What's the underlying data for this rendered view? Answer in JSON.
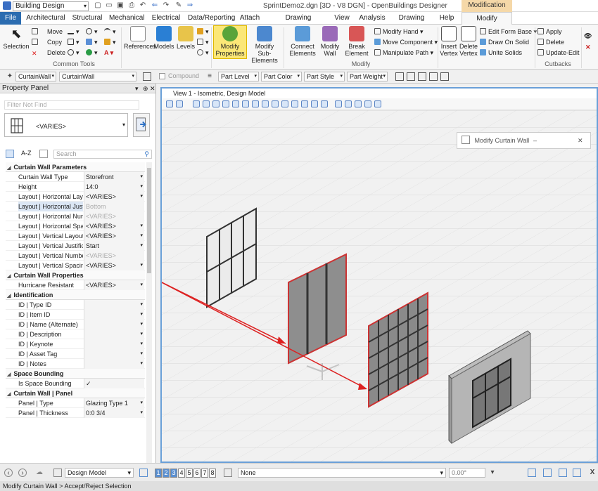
{
  "titlebar": {
    "workspace": "Building Design",
    "title": "SprintDemo2.dgn [3D - V8 DGN] - OpenBuildings Designer",
    "context_tab": "Modification"
  },
  "tabs": [
    "File",
    "Architectural",
    "Structural",
    "Mechanical",
    "Electrical",
    "Data/Reporting",
    "Attach",
    "Drawing Production",
    "View",
    "Analysis",
    "Drawing Aids",
    "Help",
    "Modify Selected"
  ],
  "ribbon": {
    "selection": "Selection",
    "move": "Move",
    "copy": "Copy",
    "delete": "Delete",
    "common_tools": "Common Tools",
    "references": "References",
    "models": "Models",
    "levels": "Levels",
    "modify_properties": "Modify\nProperties",
    "modify_sub": "Modify\nSub-Elements",
    "connect": "Connect\nElements",
    "modify_wall": "Modify\nWall",
    "break": "Break\nElement",
    "modify_hand": "Modify Hand",
    "move_component": "Move Component",
    "manipulate_path": "Manipulate Path",
    "modify_group": "Modify",
    "insert_vertex": "Insert\nVertex",
    "delete_vertex": "Delete\nVertex",
    "edit_form_base": "Edit Form Base",
    "draw_on_solid": "Draw On Solid",
    "unite_solids": "Unite Solids",
    "apply": "Apply",
    "delete2": "Delete",
    "update_edit": "Update-Edit",
    "cutbacks": "Cutbacks"
  },
  "attrbar": {
    "family": "CurtainWall",
    "part": "CurtainWall",
    "compound": "Compound",
    "part_level": "Part Level",
    "part_color": "Part Color",
    "part_style": "Part Style",
    "part_weight": "Part Weight"
  },
  "panel": {
    "title": "Property Panel",
    "filter_placeholder": "Filter Not Find",
    "selection": "<VARIES>",
    "az": "A-Z",
    "search_placeholder": "Search",
    "groups": [
      {
        "name": "Curtain Wall Parameters",
        "rows": [
          {
            "k": "Curtain Wall Type",
            "v": "Storefront",
            "dd": true
          },
          {
            "k": "Height",
            "v": "14:0",
            "dd": true
          },
          {
            "k": "Layout | Horizontal Layout",
            "v": "<VARIES>",
            "dd": true
          },
          {
            "k": "Layout | Horizontal Justification",
            "v": "Bottom",
            "dd": false,
            "sel": true,
            "gray": true
          },
          {
            "k": "Layout | Horizontal Number",
            "v": "<VARIES>",
            "dd": false,
            "gray": true
          },
          {
            "k": "Layout | Horizontal Spacing",
            "v": "<VARIES>",
            "dd": true
          },
          {
            "k": "Layout | Vertical Layout",
            "v": "<VARIES>",
            "dd": true
          },
          {
            "k": "Layout | Vertical Justification",
            "v": "Start",
            "dd": true
          },
          {
            "k": "Layout | Vertical Number",
            "v": "<VARIES>",
            "dd": false,
            "gray": true
          },
          {
            "k": "Layout | Vertical Spacing",
            "v": "<VARIES>",
            "dd": true
          }
        ]
      },
      {
        "name": "Curtain Wall Properties",
        "rows": [
          {
            "k": "Hurricane Resistant",
            "v": "<VARIES>",
            "dd": true
          }
        ]
      },
      {
        "name": "Identification",
        "rows": [
          {
            "k": "ID | Type ID",
            "v": "",
            "dd": true
          },
          {
            "k": "ID | Item ID",
            "v": "",
            "dd": true
          },
          {
            "k": "ID | Name (Alternate)",
            "v": "",
            "dd": true
          },
          {
            "k": "ID | Description",
            "v": "",
            "dd": true
          },
          {
            "k": "ID | Keynote",
            "v": "",
            "dd": true
          },
          {
            "k": "ID | Asset Tag",
            "v": "",
            "dd": true
          },
          {
            "k": "ID | Notes",
            "v": "",
            "dd": true
          }
        ]
      },
      {
        "name": "Space Bounding",
        "rows": [
          {
            "k": "Is Space Bounding",
            "v": "✓",
            "dd": false
          }
        ]
      },
      {
        "name": "Curtain Wall | Panel",
        "rows": [
          {
            "k": "Panel | Type",
            "v": "Glazing Type 1",
            "dd": true
          },
          {
            "k": "Panel | Thickness",
            "v": "0:0 3/4",
            "dd": true
          }
        ]
      }
    ]
  },
  "view": {
    "title": "View 1 - Isometric, Design Model",
    "modify_window": "Modify Curtain Wall"
  },
  "statusrow": {
    "model": "Design Model",
    "views": [
      "1",
      "2",
      "3",
      "4",
      "5",
      "6",
      "7",
      "8"
    ],
    "level": "None",
    "angle": "0.00°"
  },
  "statusbar": "Modify Curtain Wall > Accept/Reject Selection"
}
